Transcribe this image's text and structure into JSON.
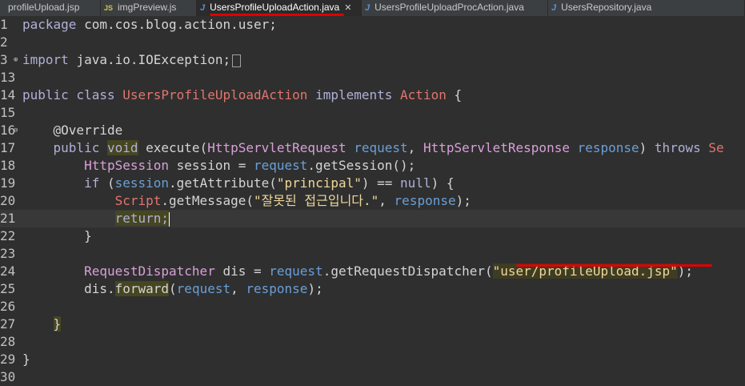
{
  "tabs": [
    {
      "icon": "jsp-file-icon",
      "icon_glyph": "",
      "label": "profileUpload.jsp",
      "active": false
    },
    {
      "icon": "js-file-icon",
      "icon_glyph": "JS",
      "label": "imgPreview.js",
      "active": false
    },
    {
      "icon": "java-file-icon",
      "icon_glyph": "J",
      "label": "UsersProfileUploadAction.java",
      "active": true,
      "close": "✕"
    },
    {
      "icon": "java-file-icon",
      "icon_glyph": "J",
      "label": "UsersProfileUploadProcAction.java",
      "active": false
    },
    {
      "icon": "java-file-icon",
      "icon_glyph": "J",
      "label": "UsersRepository.java",
      "active": false
    }
  ],
  "colors": {
    "annotation_underline": "#e00000",
    "keyword": "#cc7832",
    "string": "#f0d79a",
    "class_name": "#e2756d",
    "parameter": "#6a9fd8"
  },
  "editor": {
    "lines": [
      {
        "num": "1",
        "fold": "",
        "tokens": [
          [
            "kwp",
            "package "
          ],
          [
            "plain",
            "com.cos.blog.action.user;"
          ]
        ]
      },
      {
        "num": "2",
        "fold": "",
        "tokens": []
      },
      {
        "num": "3",
        "fold": "⊕",
        "tokens": [
          [
            "kwp",
            "import "
          ],
          [
            "plain",
            "java.io.IOException;"
          ]
        ],
        "import_box": true
      },
      {
        "num": "13",
        "fold": "",
        "tokens": []
      },
      {
        "num": "14",
        "fold": "",
        "tokens": [
          [
            "kwp",
            "public class "
          ],
          [
            "cls",
            "UsersProfileUploadAction "
          ],
          [
            "kwp",
            "implements "
          ],
          [
            "cls",
            "Action"
          ],
          [
            "plain",
            " {"
          ]
        ]
      },
      {
        "num": "15",
        "fold": "",
        "tokens": []
      },
      {
        "num": "16",
        "fold": "⊖",
        "tokens": [
          [
            "plain",
            "    "
          ],
          [
            "anno",
            "@Override"
          ]
        ]
      },
      {
        "num": "17",
        "fold": "",
        "tokens": [
          [
            "plain",
            "    "
          ],
          [
            "kwp",
            "public "
          ],
          [
            "kwp-void",
            "void"
          ],
          [
            "plain",
            " execute("
          ],
          [
            "type",
            "HttpServletRequest "
          ],
          [
            "param",
            "request"
          ],
          [
            "plain",
            ", "
          ],
          [
            "type",
            "HttpServletResponse "
          ],
          [
            "param",
            "response"
          ],
          [
            "plain",
            ") "
          ],
          [
            "kwp",
            "throws "
          ],
          [
            "cls",
            "Se"
          ]
        ]
      },
      {
        "num": "18",
        "fold": "",
        "tokens": [
          [
            "plain",
            "        "
          ],
          [
            "type",
            "HttpSession "
          ],
          [
            "plain",
            "session = "
          ],
          [
            "param",
            "request"
          ],
          [
            "plain",
            ".getSession();"
          ]
        ]
      },
      {
        "num": "19",
        "fold": "",
        "tokens": [
          [
            "plain",
            "        "
          ],
          [
            "kwp",
            "if "
          ],
          [
            "plain",
            "("
          ],
          [
            "param",
            "session"
          ],
          [
            "plain",
            ".getAttribute("
          ],
          [
            "str",
            "\"principal\""
          ],
          [
            "plain",
            ") == "
          ],
          [
            "kwp",
            "null"
          ],
          [
            "plain",
            ") {"
          ]
        ]
      },
      {
        "num": "20",
        "fold": "",
        "tokens": [
          [
            "plain",
            "            "
          ],
          [
            "cls",
            "Script"
          ],
          [
            "plain",
            ".getMessage("
          ],
          [
            "str",
            "\"잘못된 접근입니다.\""
          ],
          [
            "plain",
            ", "
          ],
          [
            "param",
            "response"
          ],
          [
            "plain",
            ");"
          ]
        ]
      },
      {
        "num": "21",
        "fold": "",
        "current": true,
        "tokens": [
          [
            "plain",
            "            "
          ],
          [
            "kw-ret",
            "return;"
          ],
          [
            "cursor",
            ""
          ]
        ]
      },
      {
        "num": "22",
        "fold": "",
        "tokens": [
          [
            "plain",
            "        }"
          ]
        ]
      },
      {
        "num": "23",
        "fold": "",
        "tokens": []
      },
      {
        "num": "24",
        "fold": "",
        "tokens": [
          [
            "plain",
            "        "
          ],
          [
            "type",
            "RequestDispatcher "
          ],
          [
            "plain",
            "dis = "
          ],
          [
            "param",
            "request"
          ],
          [
            "plain",
            ".getRequestDispatcher("
          ],
          [
            "str-hl",
            "\"user/profileUpload.jsp\""
          ],
          [
            "plain",
            ");"
          ]
        ]
      },
      {
        "num": "25",
        "fold": "",
        "tokens": [
          [
            "plain",
            "        "
          ],
          [
            "plain",
            "dis."
          ],
          [
            "fwd",
            "forward"
          ],
          [
            "plain",
            "("
          ],
          [
            "param",
            "request"
          ],
          [
            "plain",
            ", "
          ],
          [
            "param",
            "response"
          ],
          [
            "plain",
            ");"
          ]
        ]
      },
      {
        "num": "26",
        "fold": "",
        "tokens": []
      },
      {
        "num": "27",
        "fold": "",
        "tokens": [
          [
            "plain",
            "    "
          ],
          [
            "brace",
            "}"
          ]
        ]
      },
      {
        "num": "28",
        "fold": "",
        "tokens": []
      },
      {
        "num": "29",
        "fold": "",
        "tokens": [
          [
            "plain",
            "}"
          ]
        ]
      },
      {
        "num": "30",
        "fold": "",
        "tokens": []
      }
    ]
  }
}
